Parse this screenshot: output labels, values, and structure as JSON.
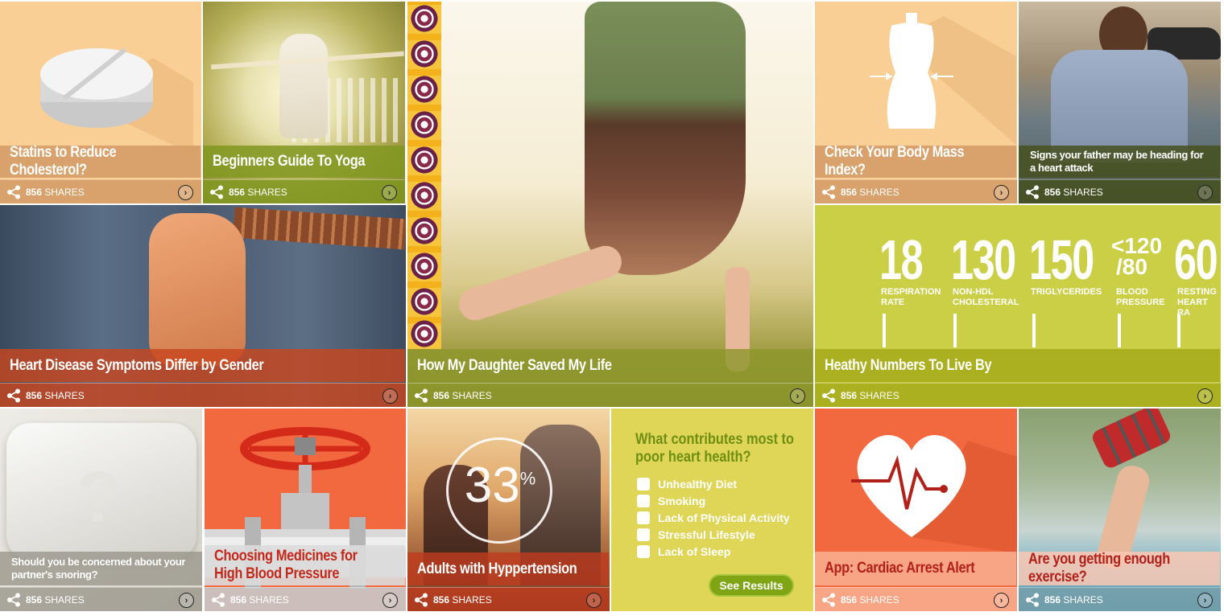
{
  "share_count": "856",
  "share_word": "SHARES",
  "tiles": {
    "statins": {
      "title": "Statins to Reduce Cholesterol?"
    },
    "yoga": {
      "title": "Beginners Guide To Yoga"
    },
    "daughter": {
      "title": "How My Daughter Saved My  Life"
    },
    "bmi": {
      "title": "Check Your Body Mass Index?"
    },
    "father": {
      "title": "Signs your father may be heading for a heart attack"
    },
    "gender": {
      "title": "Heart Disease Symptoms Differ by Gender"
    },
    "numbers": {
      "title": "Heathy Numbers To Live By",
      "stats": [
        {
          "value": "18",
          "label1": "RESPIRATION",
          "label2": "RATE"
        },
        {
          "value": "130",
          "label1": "NON-HDL",
          "label2": "CHOLESTERAL"
        },
        {
          "value": "150",
          "label1": "TRIGLYCERIDES",
          "label2": ""
        },
        {
          "value": "<120/80",
          "value_top": "<120",
          "value_bottom": "/80",
          "label1": "BLOOD",
          "label2": "PRESSURE"
        },
        {
          "value": "60",
          "label1": "RESTING",
          "label2": "HEART RA"
        }
      ]
    },
    "snoring": {
      "title": "Should you be concerned about your partner's snoring?",
      "glyph": "?"
    },
    "medicines": {
      "title": "Choosing Medicines for High Blood Pressure"
    },
    "hypertension": {
      "title": "Adults with Hyppertension",
      "percent": "33",
      "percent_sign": "%"
    },
    "quiz": {
      "question": "What contributes most to poor heart health?",
      "options": [
        "Unhealthy Diet",
        "Smoking",
        "Lack of Physical Activity",
        "Stressful Lifestyle",
        "Lack of Sleep"
      ],
      "button": "See Results"
    },
    "cardiac": {
      "title": "App: Cardiac Arrest Alert"
    },
    "exercise": {
      "title": "Are you getting enough exercise?"
    }
  },
  "colors": {
    "peach": "#f9cf95",
    "peach_caption": "#d9a06a",
    "olive": "#b7bd2a",
    "orange": "#f26a43",
    "quiz_yellow": "#dfd657",
    "quiz_green": "#7fa515"
  },
  "icons": [
    "share-icon",
    "arrow-circle-icon",
    "pill-icon",
    "mannequin-icon",
    "heart-icon",
    "valve-icon",
    "pillow-icon",
    "checkbox-icon"
  ]
}
